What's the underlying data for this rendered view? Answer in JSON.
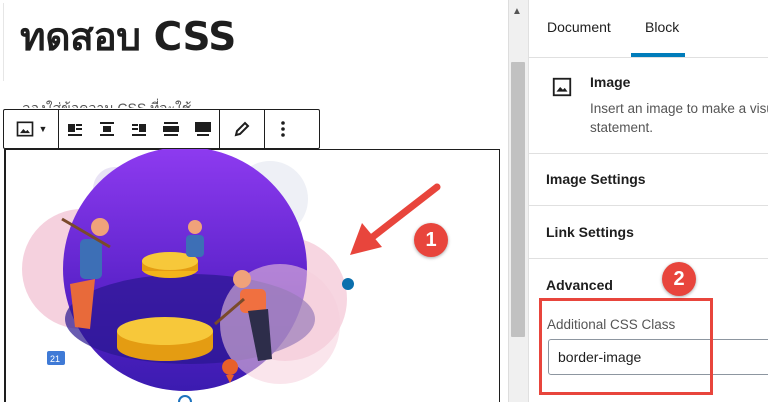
{
  "editor": {
    "post_title": "ทดสอบ CSS",
    "paragraph_snippet": "ลองใส่ข้อความ CSS ที่จะใช้"
  },
  "toolbar": {
    "items": [
      {
        "name": "image-block-type-icon"
      },
      {
        "name": "align-left-icon"
      },
      {
        "name": "align-center-icon"
      },
      {
        "name": "align-right-icon"
      },
      {
        "name": "wide-width-icon"
      },
      {
        "name": "full-width-icon"
      },
      {
        "name": "edit-pencil-icon"
      },
      {
        "name": "more-options-icon"
      }
    ]
  },
  "sidebar": {
    "tabs": [
      "Document",
      "Block"
    ],
    "active_tab": "Block",
    "block": {
      "name": "Image",
      "description": "Insert an image to make a visual statement."
    },
    "panels": {
      "image_settings": "Image Settings",
      "link_settings": "Link Settings",
      "advanced": "Advanced"
    },
    "additional_css_label": "Additional CSS Class",
    "additional_css_value": "border-image"
  },
  "callouts": {
    "one": "1",
    "two": "2"
  },
  "colors": {
    "accent": "#007cba",
    "callout_red": "#e8453c"
  }
}
